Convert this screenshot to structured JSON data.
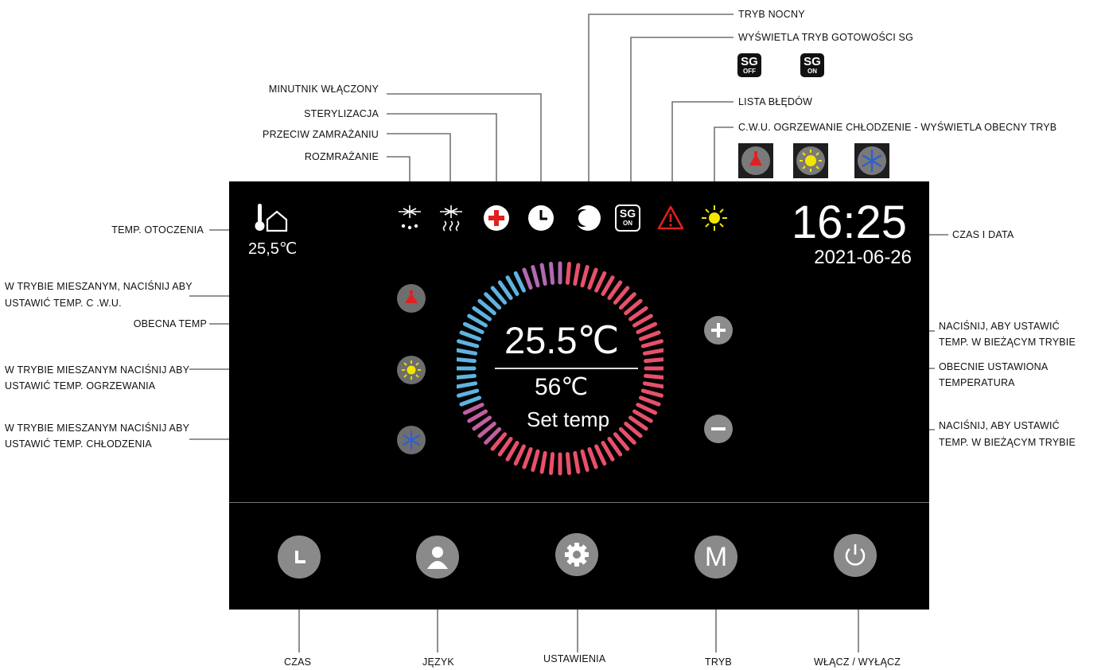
{
  "labels": {
    "tryb_nocny": "TRYB NOCNY",
    "sg_display": "WYŚWIETLA TRYB GOTOWOŚCI SG",
    "lista_bledow": "LISTA BŁĘDÓW",
    "cwu_mode": "C.W.U. OGRZEWANIE CHŁODZENIE - WYŚWIETLA OBECNY TRYB",
    "minutnik": "MINUTNIK WŁĄCZONY",
    "sterylizacja": "STERYLIZACJA",
    "przeciw_zamrazaniu": "PRZECIW ZAMRAŻANIU",
    "rozmrazanie": "ROZMRAŻANIE",
    "temp_otoczenia": "TEMP. OTOCZENIA",
    "czas_i_data": "CZAS I DATA",
    "mixed_cwu_1": "W TRYBIE MIESZANYM, NACIŚNIJ ABY",
    "mixed_cwu_2": "USTAWIĆ TEMP. C .W.U.",
    "obecna_temp": "OBECNA TEMP",
    "mixed_heat_1": "W TRYBIE MIESZANYM NACIŚNIJ ABY",
    "mixed_heat_2": "USTAWIĆ TEMP. OGRZEWANIA",
    "mixed_cool_1": "W TRYBIE MIESZANYM NACIŚNIJ ABY",
    "mixed_cool_2": "USTAWIĆ TEMP. CHŁODZENIA",
    "plus_1": "NACIŚNIJ, ABY USTAWIĆ",
    "plus_2": "TEMP. W BIEŻĄCYM TRYBIE",
    "set_1": "OBECNIE USTAWIONA",
    "set_2": "TEMPERATURA",
    "minus_1": "NACIŚNIJ, ABY USTAWIĆ",
    "minus_2": "TEMP. W BIEŻĄCYM TRYBIE",
    "czas": "CZAS",
    "jezyk": "JĘZYK",
    "ustawienia": "USTAWIENIA",
    "tryb": "TRYB",
    "wlacz": "WŁĄCZ / WYŁĄCZ"
  },
  "sg_badges": {
    "off_top": "SG",
    "off_bottom": "OFF",
    "on_top": "SG",
    "on_bottom": "ON"
  },
  "screen": {
    "ambient_temp": "25,5℃",
    "time": "16:25",
    "date": "2021-06-26",
    "current_temp": "25.5℃",
    "set_temp_value": "56℃",
    "set_temp_label": "Set temp",
    "mode_button_label": "M",
    "status_sg_top": "SG",
    "status_sg_bottom": "ON"
  },
  "icons": [
    "defrost-icon",
    "antifreeze-icon",
    "sterilization-icon",
    "timer-icon",
    "night-mode-icon",
    "sg-icon",
    "error-icon",
    "sun-icon",
    "tap-icon",
    "snowflake-icon",
    "clock-icon",
    "user-icon",
    "gear-icon",
    "power-icon",
    "plus-icon",
    "minus-icon",
    "thermometer-house-icon"
  ],
  "colors": {
    "panel": "#000000",
    "ring_cool": "#5fb3e0",
    "ring_hot": "#e8506a",
    "error_red": "#e02020",
    "sun_yellow": "#f2e600",
    "icon_gray": "#8a8a8a"
  }
}
